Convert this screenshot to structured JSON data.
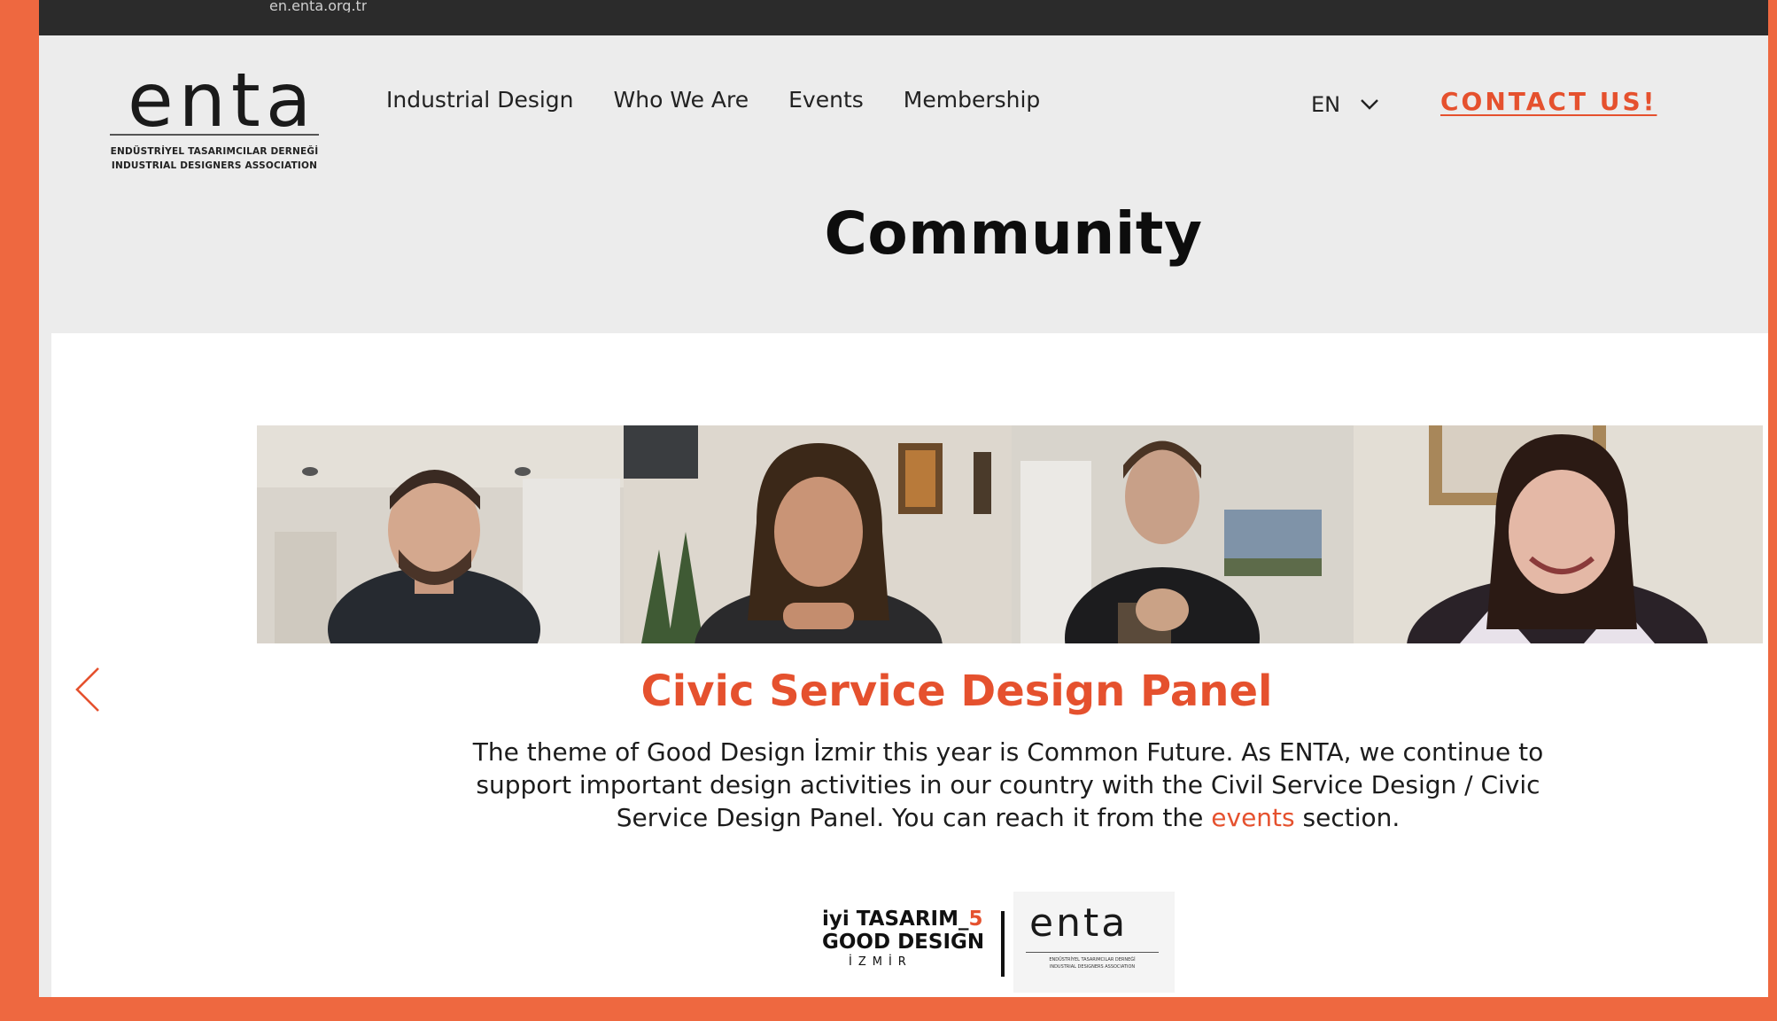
{
  "browser": {
    "url": "en.enta.org.tr"
  },
  "header": {
    "logo": {
      "wordmark": "enta",
      "subtitle_tr": "ENDÜSTRİYEL TASARIMCILAR DERNEĞİ",
      "subtitle_en": "INDUSTRIAL DESIGNERS ASSOCIATION"
    },
    "nav": [
      {
        "label": "Industrial Design"
      },
      {
        "label": "Who We Are"
      },
      {
        "label": "Events"
      },
      {
        "label": "Membership"
      }
    ],
    "language": "EN",
    "contact_label": "CONTACT US!"
  },
  "page": {
    "title": "Community"
  },
  "slide": {
    "headline": "Civic Service Design Panel",
    "description_before_link": "The theme of Good Design İzmir this year is Common Future. As ENTA, we continue to support important design activities in our country with the Civil Service Design / Civic Service Design Panel. You can reach it from the ",
    "link_text": "events",
    "description_after_link": " section.",
    "partner_logos": {
      "line1": "iyi TASARIM_",
      "line1_number": "5",
      "line2": "GOOD DESIGN",
      "city": "İZMİR",
      "enta_wordmark": "enta",
      "enta_sub_tr": "ENDÜSTRİYEL TASARIMCILAR DERNEĞİ",
      "enta_sub_en": "INDUSTRIAL DESIGNERS ASSOCIATION"
    }
  },
  "colors": {
    "accent": "#e5512e",
    "frame": "#ee6840",
    "header_bg": "#ececec"
  }
}
